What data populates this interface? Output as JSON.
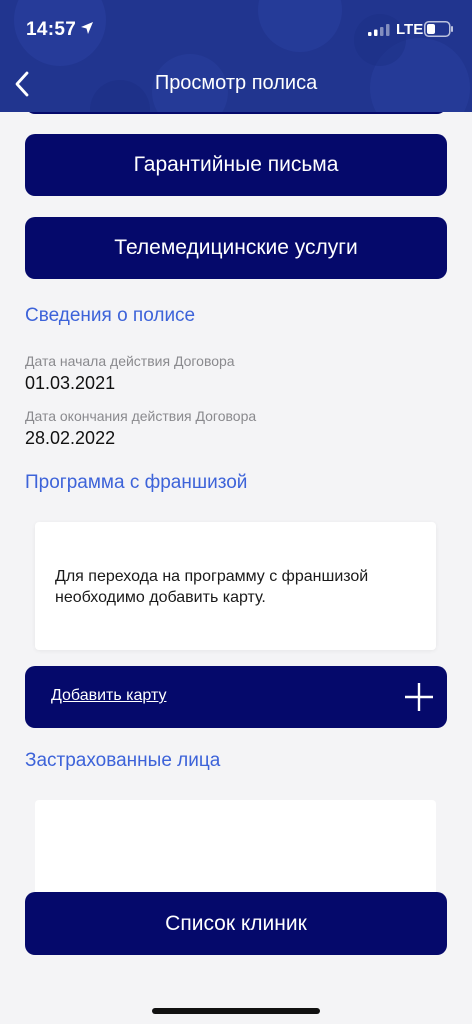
{
  "status_bar": {
    "time": "14:57",
    "network": "LTE",
    "icons": [
      "location-arrow-icon",
      "signal-icon",
      "battery-icon"
    ]
  },
  "nav": {
    "title": "Просмотр полиса",
    "back_icon": "chevron-left-icon"
  },
  "buttons": {
    "guarantee_letters": "Гарантийные письма",
    "telemedicine": "Телемедицинские услуги",
    "clinic_list": "Список клиник"
  },
  "policy_info": {
    "title": "Сведения о полисе",
    "start_label": "Дата начала действия Договора",
    "start_value": "01.03.2021",
    "end_label": "Дата окончания действия Договора",
    "end_value": "28.02.2022"
  },
  "franchise": {
    "title": "Программа с франшизой",
    "message": "Для перехода на программу с франшизой необходимо добавить карту.",
    "add_card_label": "Добавить карту",
    "add_icon": "plus-icon"
  },
  "insured": {
    "title": "Застрахованные лица"
  },
  "colors": {
    "header_bg": "#21358f",
    "button_bg": "#05096b",
    "accent_text": "#3d63d9",
    "page_bg": "#f4f4f6"
  }
}
